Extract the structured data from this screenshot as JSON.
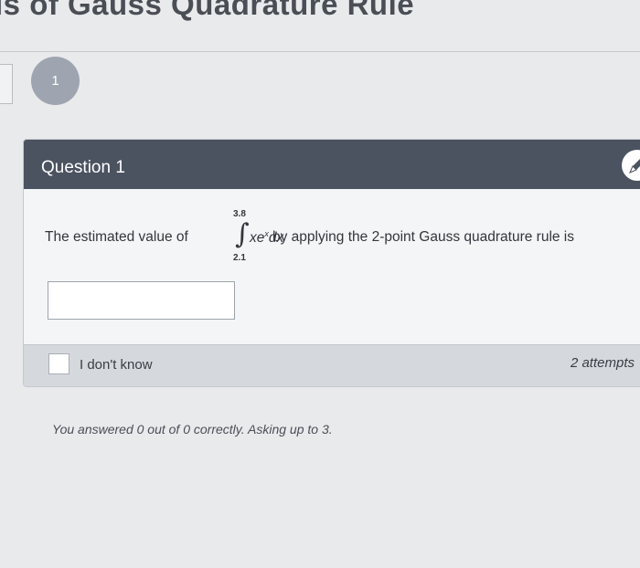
{
  "page": {
    "title": "ls of Gauss Quadrature Rule"
  },
  "question_nav": {
    "number": "1"
  },
  "question": {
    "title": "Question 1",
    "prompt_before": "The estimated value of",
    "integral": {
      "upper_limit": "3.8",
      "lower_limit": "2.1",
      "sign": "∫",
      "integrand_base": "xe",
      "integrand_exponent": "x",
      "differential": "dx"
    },
    "prompt_after": "by applying the 2-point Gauss quadrature rule is",
    "answer": {
      "value": "",
      "placeholder": ""
    },
    "dont_know_label": "I don't know",
    "attempts_label": "2 attempts"
  },
  "status": {
    "message": "You answered 0 out of 0 correctly. Asking up to 3."
  },
  "icons": {
    "edit": "pencil-icon"
  },
  "colors": {
    "header_bg": "#4b5260",
    "card_bg": "#f4f5f6",
    "footer_bg": "#d5d8dd",
    "bubble_bg": "#9fa5b0",
    "page_bg": "#e9eaec"
  }
}
